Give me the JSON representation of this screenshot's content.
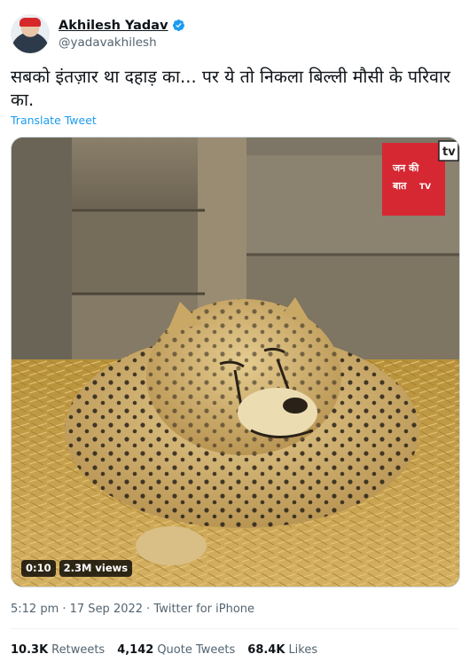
{
  "author": {
    "display_name": "Akhilesh Yadav",
    "handle": "@yadavakhilesh",
    "verified": true
  },
  "tweet": {
    "text": "सबको इंतज़ार था दहाड़ का... पर ये तो निकला बिल्ली मौसी के परिवार का.",
    "translate_label": "Translate Tweet"
  },
  "video": {
    "duration": "0:10",
    "views": "2.3M views",
    "watermark_text_1": "जन की",
    "watermark_text_2": "बात",
    "watermark_text_3": "TV",
    "tv_label": "tv"
  },
  "meta": {
    "timestamp": "5:12 pm · 17 Sep 2022 · Twitter for iPhone"
  },
  "stats": {
    "retweets_count": "10.3K",
    "retweets_label": "Retweets",
    "quotes_count": "4,142",
    "quotes_label": "Quote Tweets",
    "likes_count": "68.4K",
    "likes_label": "Likes"
  },
  "colors": {
    "accent": "#1d9bf0",
    "muted": "#536471",
    "watermark_red": "#d62833"
  }
}
